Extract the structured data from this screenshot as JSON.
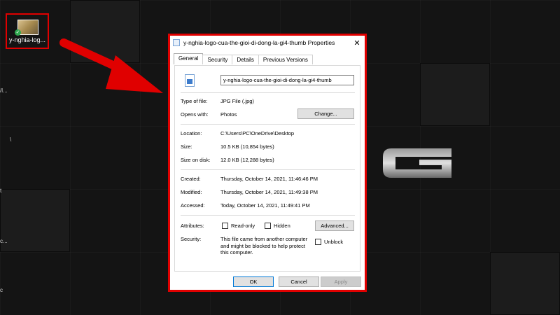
{
  "desktop": {
    "icon_label": "y-nghia-log...",
    "side_glyphs": [
      "/l...",
      "\\",
      "t",
      "c...",
      "c"
    ]
  },
  "dialog": {
    "title": "y-nghia-logo-cua-the-gioi-di-dong-la-gi4-thumb Properties",
    "close": "✕",
    "tabs": [
      "General",
      "Security",
      "Details",
      "Previous Versions"
    ],
    "file_name": "y-nghia-logo-cua-the-gioi-di-dong-la-gi4-thumb",
    "type_of_file": {
      "label": "Type of file:",
      "value": "JPG File (.jpg)"
    },
    "opens_with": {
      "label": "Opens with:",
      "value": "Photos",
      "button": "Change..."
    },
    "location": {
      "label": "Location:",
      "value": "C:\\Users\\PC\\OneDrive\\Desktop"
    },
    "size": {
      "label": "Size:",
      "value": "10.5 KB (10,854 bytes)"
    },
    "size_on_disk": {
      "label": "Size on disk:",
      "value": "12.0 KB (12,288 bytes)"
    },
    "created": {
      "label": "Created:",
      "value": "Thursday, October 14, 2021, 11:46:46 PM"
    },
    "modified": {
      "label": "Modified:",
      "value": "Thursday, October 14, 2021, 11:49:38 PM"
    },
    "accessed": {
      "label": "Accessed:",
      "value": "Today, October 14, 2021, 11:49:41 PM"
    },
    "attributes": {
      "label": "Attributes:",
      "readonly": "Read-only",
      "hidden": "Hidden",
      "advanced": "Advanced..."
    },
    "security": {
      "label": "Security:",
      "text": "This file came from another computer and might be blocked to help protect this computer.",
      "unblock": "Unblock"
    },
    "buttons": {
      "ok": "OK",
      "cancel": "Cancel",
      "apply": "Apply"
    }
  },
  "colors": {
    "highlight": "#e00000",
    "accent": "#0078d7"
  }
}
